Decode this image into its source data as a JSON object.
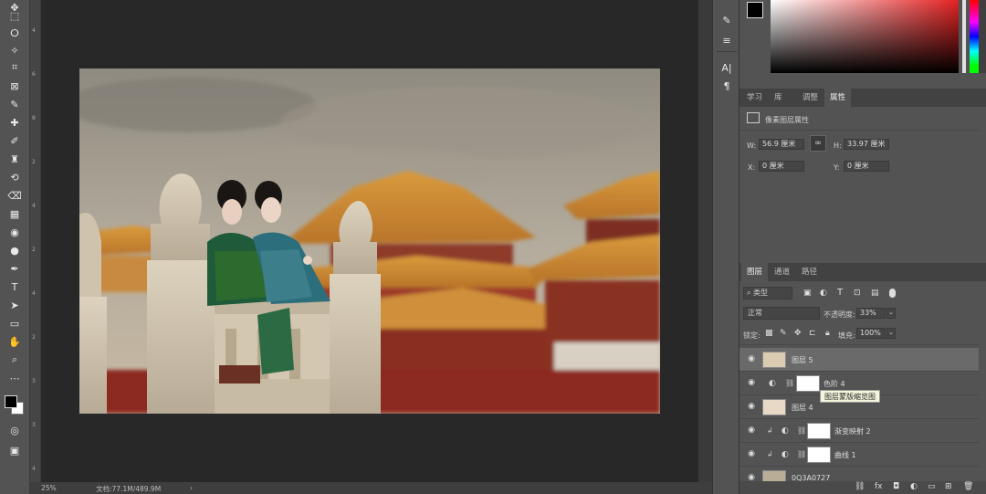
{
  "status": {
    "zoom": "25%",
    "doc_info": "文档:77.1M/489.9M",
    "arrow": "›"
  },
  "ruler": {
    "marks": [
      "4",
      "6",
      "8",
      "2",
      "4",
      "2",
      "4",
      "2",
      "3",
      "3",
      "4"
    ]
  },
  "toolbar": {
    "tools": [
      "move-icon",
      "marquee-icon",
      "lasso-icon",
      "magic-wand-icon",
      "crop-icon",
      "frame-icon",
      "eyedropper-icon",
      "healing-icon",
      "brush-icon",
      "stamp-icon",
      "history-brush-icon",
      "eraser-icon",
      "gradient-icon",
      "blur-icon",
      "dodge-icon",
      "pen-icon",
      "type-icon",
      "path-select-icon",
      "rectangle-icon",
      "hand-icon",
      "zoom-icon",
      "more-icon"
    ],
    "glyphs": [
      "✥",
      "⬚",
      "ⵔ",
      "✧",
      "⌗",
      "⊠",
      "✎",
      "✚",
      "✐",
      "♜",
      "⟲",
      "⌫",
      "▦",
      "◉",
      "●",
      "✒",
      "T",
      "➤",
      "▭",
      "✋",
      "⌕",
      "⋯"
    ]
  },
  "colors": {
    "foreground": "#000000",
    "background": "#ffffff"
  },
  "properties": {
    "tabs": [
      "学习",
      "库",
      "调整",
      "属性"
    ],
    "active_tab": "属性",
    "title": "像素图层属性",
    "w_label": "W:",
    "w_value": "56.9 厘米",
    "h_label": "H:",
    "h_value": "33.97 厘米",
    "x_label": "X:",
    "x_value": "0 厘米",
    "y_label": "Y:",
    "y_value": "0 厘米"
  },
  "layers_panel": {
    "tabs": [
      "图层",
      "通道",
      "路径"
    ],
    "active_tab": "图层",
    "filter_label": "类型",
    "blend_mode": "正常",
    "opacity_label": "不透明度:",
    "opacity_value": "33%",
    "lock_label": "锁定:",
    "fill_label": "填充:",
    "fill_value": "100%",
    "tooltip": "图层蒙版缩览图",
    "layers": [
      {
        "name": "图层 5",
        "selected": true
      },
      {
        "name": "色阶 4",
        "selected": false
      },
      {
        "name": "图层 4",
        "selected": false
      },
      {
        "name": "渐变映射 2",
        "selected": false
      },
      {
        "name": "曲线 1",
        "selected": false
      },
      {
        "name": "0Q3A0727",
        "selected": false
      }
    ]
  }
}
